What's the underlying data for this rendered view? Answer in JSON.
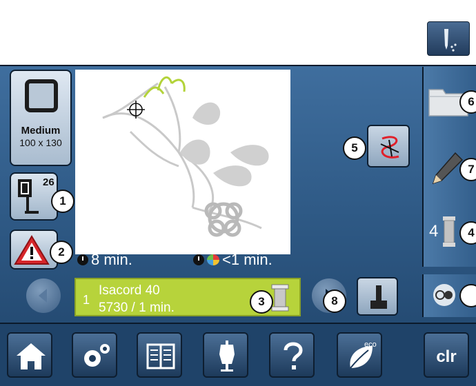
{
  "hoop": {
    "name": "Medium",
    "size": "100 x 130"
  },
  "presser_foot": {
    "number": "26"
  },
  "callouts": [
    "1",
    "2",
    "3",
    "4",
    "5",
    "6",
    "7",
    "8"
  ],
  "times": {
    "total": "8 min.",
    "color_segment": "<1 min."
  },
  "thread": {
    "index": "1",
    "name": "Isacord 40",
    "detail": "5730 / 1 min."
  },
  "side_menu": {
    "color_count": "4"
  },
  "bottom_nav": {
    "clr_label": "clr",
    "eco_label": "eco"
  },
  "colors": {
    "accent_green": "#b7d33b",
    "screen_blue": "#2f5a86",
    "warning_red": "#d7262b"
  },
  "icons": [
    "needle-icon",
    "hoop-icon",
    "presser-foot-icon",
    "warning-icon",
    "resew-icon",
    "folder-icon",
    "pencil-icon",
    "thread-spool-icon",
    "record-icon",
    "prev-arrow-icon",
    "next-arrow-icon",
    "thread-cutter-icon",
    "home-icon",
    "settings-icon",
    "tutorial-icon",
    "sewing-consultant-icon",
    "help-icon",
    "eco-icon"
  ]
}
